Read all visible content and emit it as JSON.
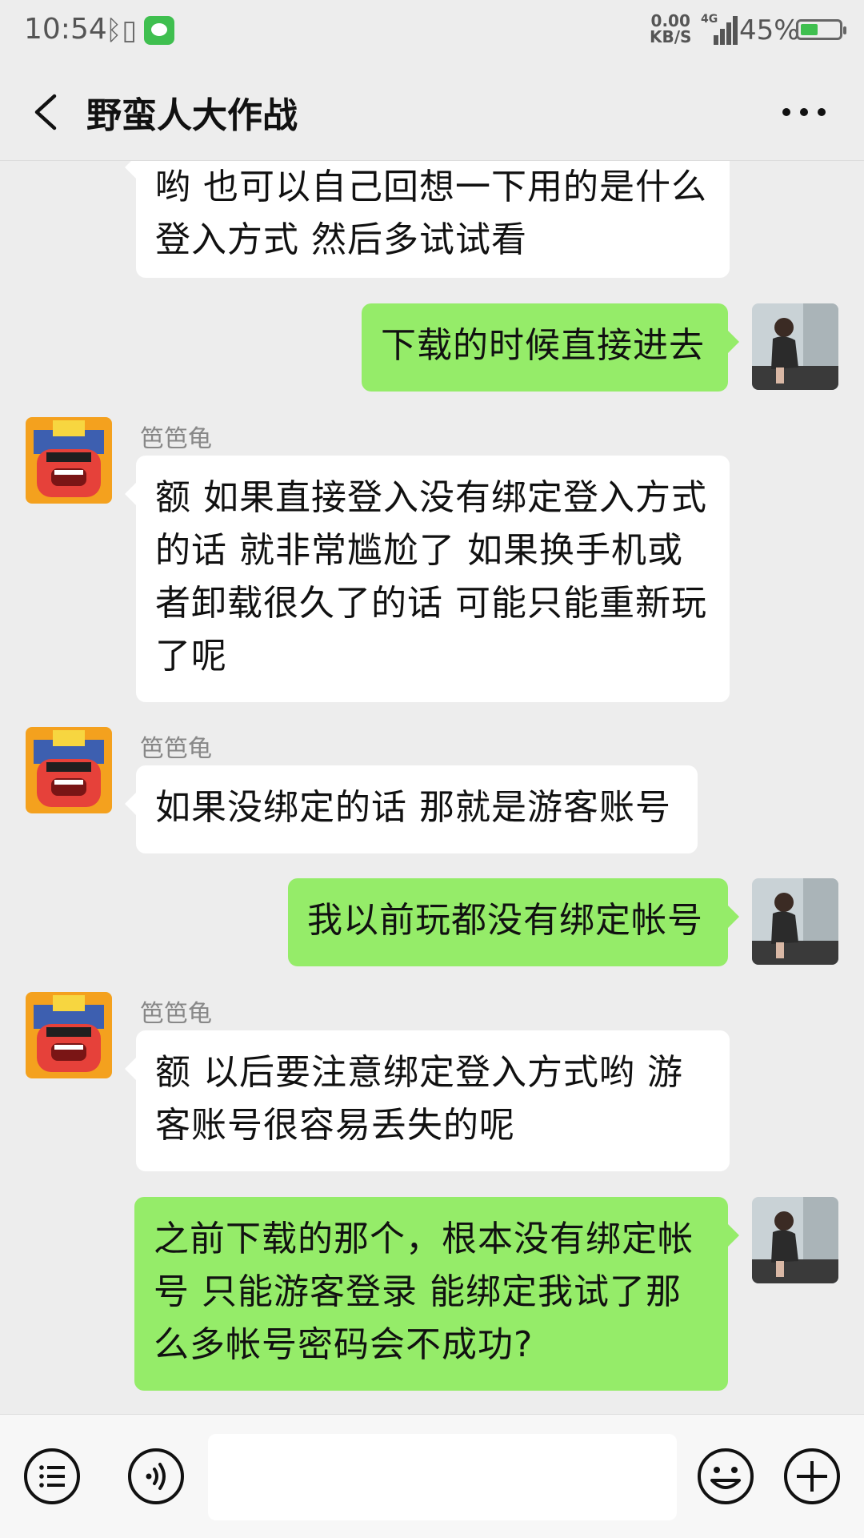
{
  "status_bar": {
    "time": "10:54",
    "speed_value": "0.00",
    "speed_unit": "KB/S",
    "network": "4G",
    "battery_percent": "45%",
    "battery_level": 0.45,
    "icons": [
      "bluetooth-vibrate-icon",
      "message-icon",
      "signal-icon",
      "battery-icon"
    ]
  },
  "header": {
    "title": "野蛮人大作战",
    "back_icon": "chevron-left-icon",
    "more_icon": "more-dots-icon"
  },
  "messages": [
    {
      "side": "left",
      "sender": "",
      "text": "哟 也可以自己回想一下用的是什么登入方式 然后多试试看"
    },
    {
      "side": "right",
      "text": "下载的时候直接进去"
    },
    {
      "side": "left",
      "sender": "笆笆龟",
      "text": "额 如果直接登入没有绑定登入方式的话  就非常尴尬了 如果换手机或者卸载很久了的话 可能只能重新玩了呢"
    },
    {
      "side": "left",
      "sender": "笆笆龟",
      "text": "如果没绑定的话 那就是游客账号"
    },
    {
      "side": "right",
      "text": "我以前玩都没有绑定帐号"
    },
    {
      "side": "left",
      "sender": "笆笆龟",
      "text": "额 以后要注意绑定登入方式哟 游客账号很容易丢失的呢"
    },
    {
      "side": "right",
      "text": "之前下载的那个，根本没有绑定帐号  只能游客登录  能绑定我试了那么多帐号密码会不成功?"
    }
  ],
  "input_bar": {
    "placeholder": "",
    "icons": [
      "menu-list-icon",
      "voice-icon",
      "emoji-icon",
      "add-icon"
    ]
  },
  "colors": {
    "background": "#ededed",
    "bubble_self": "#95ec69",
    "bubble_other": "#ffffff",
    "accent_green": "#3fbf4f"
  }
}
